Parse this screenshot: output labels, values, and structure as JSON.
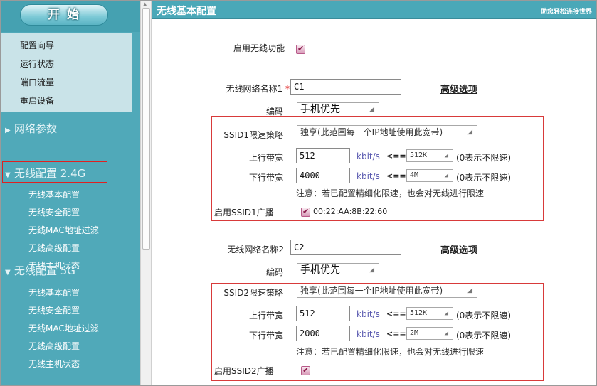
{
  "sidebar": {
    "start_label": "开 始",
    "quick_menu": [
      "配置向导",
      "运行状态",
      "端口流量",
      "重启设备"
    ],
    "groups": [
      {
        "label": "网络参数",
        "items": []
      },
      {
        "label": "无线配置 2.4G",
        "items": [
          "无线基本配置",
          "无线安全配置",
          "无线MAC地址过滤",
          "无线高级配置",
          "无线主机状态"
        ]
      },
      {
        "label": "无线配置 5G",
        "items": [
          "无线基本配置",
          "无线安全配置",
          "无线MAC地址过滤",
          "无线高级配置",
          "无线主机状态"
        ]
      }
    ]
  },
  "main": {
    "title": "无线基本配置",
    "slogan": "助您轻松连接世界",
    "enable_wireless_label": "启用无线功能",
    "enable_wireless_checked": true,
    "ssid1": {
      "name_label": "无线网络名称1",
      "required_mark": "*",
      "name_value": "C1",
      "advanced_link": "高级选项",
      "encoding_label": "编码",
      "encoding_value": "手机优先",
      "policy_label": "SSID1限速策略",
      "policy_value": "独享(此范围每一个IP地址使用此宽带)",
      "up_label": "上行带宽",
      "up_value": "512",
      "up_unit": "kbit/s",
      "up_arrow": "<==",
      "up_preset": "512K",
      "up_note": "(0表示不限速)",
      "down_label": "下行带宽",
      "down_value": "4000",
      "down_unit": "kbit/s",
      "down_arrow": "<==",
      "down_preset": "4M",
      "down_note": "(0表示不限速)",
      "notice": "注意：若已配置精细化限速，也会对无线进行限速",
      "broadcast_label": "启用SSID1广播",
      "broadcast_checked": true,
      "mac": "00:22:AA:8B:22:60"
    },
    "ssid2": {
      "name_label": "无线网络名称2",
      "name_value": "C2",
      "advanced_link": "高级选项",
      "encoding_label": "编码",
      "encoding_value": "手机优先",
      "policy_label": "SSID2限速策略",
      "policy_value": "独享(此范围每一个IP地址使用此宽带)",
      "up_label": "上行带宽",
      "up_value": "512",
      "up_unit": "kbit/s",
      "up_arrow": "<==",
      "up_preset": "512K",
      "up_note": "(0表示不限速)",
      "down_label": "下行带宽",
      "down_value": "2000",
      "down_unit": "kbit/s",
      "down_arrow": "<==",
      "down_preset": "2M",
      "down_note": "(0表示不限速)",
      "notice": "注意：若已配置精细化限速，也会对无线进行限速",
      "broadcast_label": "启用SSID2广播",
      "broadcast_checked": true
    }
  },
  "colors": {
    "sidebar_bg": "#50a9b9",
    "title_bar_bg": "#4aa8b8",
    "highlight_border": "#d83a3a"
  }
}
